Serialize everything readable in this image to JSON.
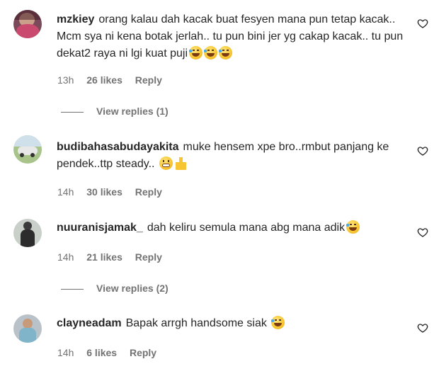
{
  "comments": [
    {
      "username": "mzkiey",
      "text": "orang kalau dah kacak buat fesyen mana pun tetap kacak.. Mcm sya ni kena botak jerlah.. tu pun bini jer yg cakap kacak.. tu pun dekat2 raya ni lgi kuat puji",
      "time": "13h",
      "likes": "26 likes",
      "reply": "Reply",
      "view_replies": "View replies (1)"
    },
    {
      "username": "budibahasabudayakita",
      "text": "muke hensem xpe bro..rmbut panjang ke pendek..ttp steady..",
      "time": "14h",
      "likes": "30 likes",
      "reply": "Reply"
    },
    {
      "username": "nuuranisjamak_",
      "text": "dah keliru semula mana abg mana adik",
      "time": "14h",
      "likes": "21 likes",
      "reply": "Reply",
      "view_replies": "View replies (2)"
    },
    {
      "username": "clayneadam",
      "text": "Bapak arrgh handsome siak",
      "time": "14h",
      "likes": "6 likes",
      "reply": "Reply"
    }
  ],
  "icons": {
    "like": "heart-outline-icon",
    "emoji_laugh": "tears-of-joy-emoji",
    "emoji_grimace": "grimacing-emoji",
    "emoji_thumbs": "thumbs-up-emoji"
  },
  "colors": {
    "text": "#262626",
    "secondary": "#737373"
  }
}
